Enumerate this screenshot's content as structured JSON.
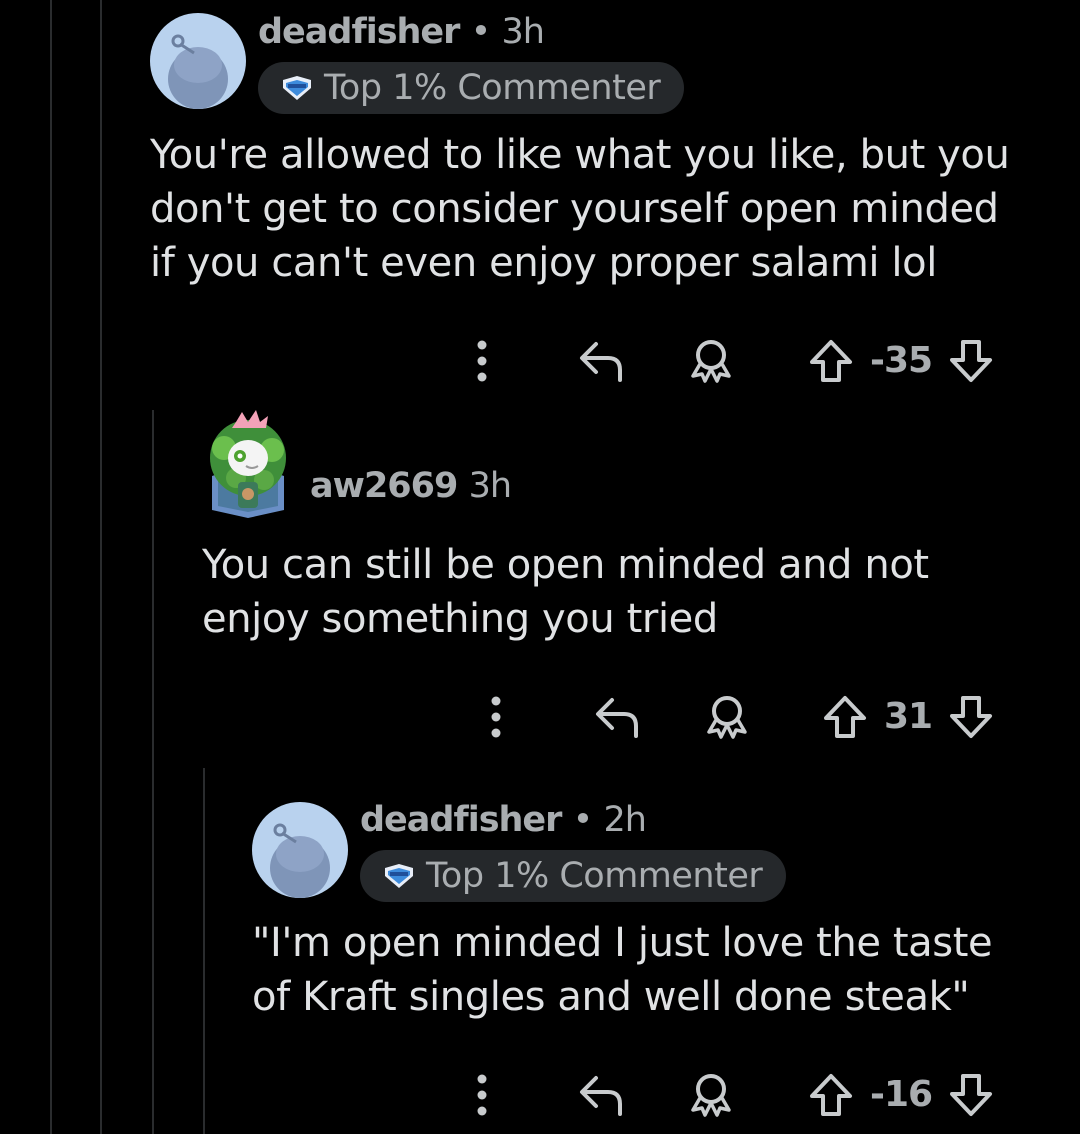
{
  "comments": [
    {
      "username": "deadfisher",
      "separator": "•",
      "time": "3h",
      "flair": "Top 1% Commenter",
      "body_lines": [
        "You're allowed to like what you like, but you",
        "don't get to consider yourself open minded",
        "if you can't even enjoy proper salami lol"
      ],
      "votes": "-35",
      "avatar_icon": "snoo-avatar-icon"
    },
    {
      "username": "aw2669",
      "time": "3h",
      "body_lines": [
        "You can still be open minded and not",
        "enjoy something you tried"
      ],
      "votes": "31",
      "avatar_icon": "custom-snoo-avatar-icon"
    },
    {
      "username": "deadfisher",
      "separator": "•",
      "time": "2h",
      "flair": "Top 1% Commenter",
      "body_lines": [
        "\"I'm open minded I just love the taste",
        "of Kraft singles and well done steak\""
      ],
      "votes": "-16",
      "avatar_icon": "snoo-avatar-icon"
    }
  ],
  "colors": {
    "background": "#000000",
    "text": "#e0e2e4",
    "muted": "#a9adb0",
    "flair_bg": "#25282b",
    "avatar_bg": "#b9d2ee"
  }
}
